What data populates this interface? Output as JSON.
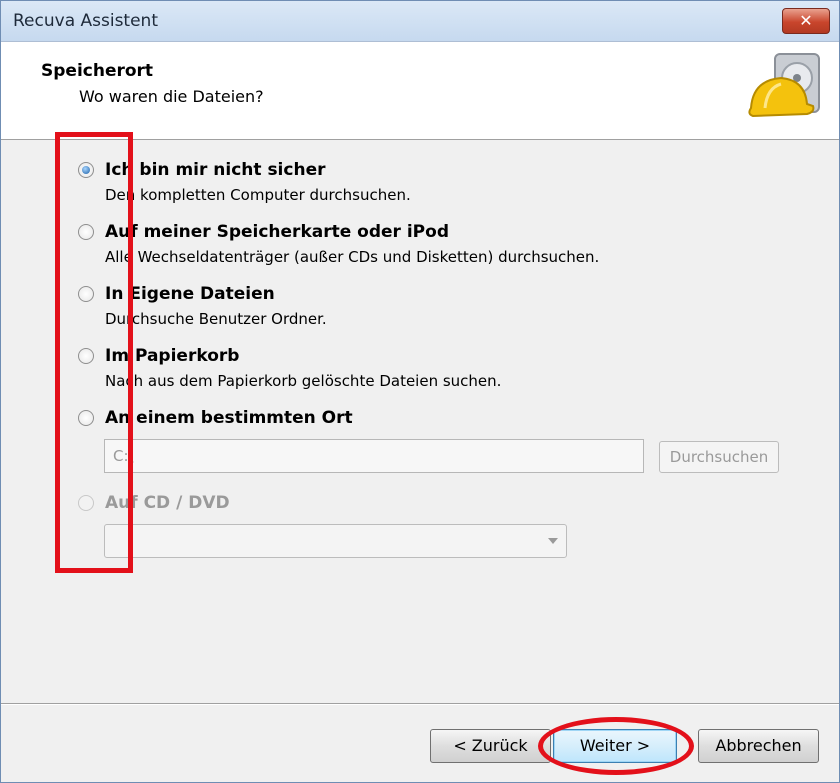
{
  "window": {
    "title": "Recuva Assistent",
    "close_label": "✕"
  },
  "header": {
    "title": "Speicherort",
    "subtitle": "Wo waren die Dateien?"
  },
  "options": [
    {
      "label": "Ich bin mir nicht sicher",
      "desc": "Den kompletten Computer durchsuchen.",
      "checked": true,
      "enabled": true
    },
    {
      "label": "Auf meiner Speicherkarte oder iPod",
      "desc": "Alle Wechseldatenträger (außer CDs und Disketten) durchsuchen.",
      "checked": false,
      "enabled": true
    },
    {
      "label": "In Eigene Dateien",
      "desc": "Durchsuche Benutzer Ordner.",
      "checked": false,
      "enabled": true
    },
    {
      "label": "Im Papierkorb",
      "desc": "Nach aus dem Papierkorb gelöschte Dateien suchen.",
      "checked": false,
      "enabled": true
    },
    {
      "label": "An einem bestimmten Ort",
      "checked": false,
      "enabled": true
    },
    {
      "label": "Auf CD / DVD",
      "checked": false,
      "enabled": false
    }
  ],
  "location": {
    "path_value": "C:\\",
    "browse_label": "Durchsuchen"
  },
  "cd_dvd": {
    "selected": ""
  },
  "buttons": {
    "back": "< Zurück",
    "next": "Weiter >",
    "cancel": "Abbrechen"
  },
  "colors": {
    "annotation": "#e3101a",
    "title_bar": "#c6d9ef",
    "radio_selected": "#1b5fa6"
  }
}
